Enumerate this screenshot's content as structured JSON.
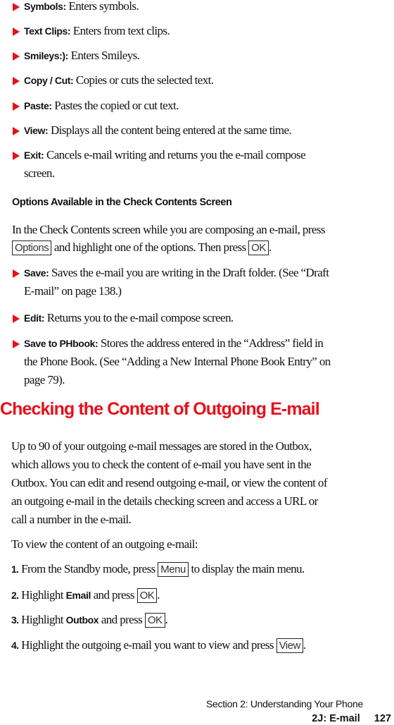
{
  "options_list": [
    {
      "term": "Symbols:",
      "desc": "Enters symbols."
    },
    {
      "term": "Text Clips:",
      "desc": "Enters from text clips."
    },
    {
      "term": "Smileys:):",
      "desc": "Enters Smileys."
    },
    {
      "term": "Copy / Cut:",
      "desc": "Copies or cuts the selected text."
    },
    {
      "term": "Paste:",
      "desc": "Pastes the copied or cut text."
    },
    {
      "term": "View:",
      "desc": "Displays all the content being entered at the same time."
    },
    {
      "term": "Exit:",
      "desc": "Cancels e-mail writing and returns you the e-mail compose",
      "desc2": "screen."
    }
  ],
  "check_contents": {
    "heading": "Options Available in the Check Contents Screen",
    "intro_line1": "In the Check Contents screen while you are composing an e-mail, press",
    "intro_key1": "Options",
    "intro_line2": "and highlight one of the options. Then press",
    "intro_key2": "OK",
    "intro_end": ".",
    "items": [
      {
        "term": "Save:",
        "desc": "Saves the e-mail you are writing in the Draft folder. (See “Draft",
        "desc2": "E-mail” on page 138.)"
      },
      {
        "term": "Edit:",
        "desc": "Returns you to the e-mail compose screen."
      },
      {
        "term": "Save to PHbook:",
        "desc": "Stores the address entered in the “Address” field in",
        "desc2": "the Phone Book. (See “Adding a New Internal Phone Book Entry” on",
        "desc3": "page 79)."
      }
    ]
  },
  "section": {
    "title": "Checking the Content of Outgoing E-mail",
    "paragraph": [
      "Up to 90 of your outgoing e-mail messages are stored in the Outbox,",
      "which allows you to check the content of e-mail you have sent in the",
      "Outbox. You can edit and resend outgoing e-mail, or view the content of",
      "an outgoing e-mail in the details checking screen and access a URL or",
      "call a number in the e-mail."
    ],
    "steps_intro": "To view the content of an outgoing e-mail:",
    "steps": [
      {
        "num": "1.",
        "pre": "From the Standby mode, press",
        "key": "Menu",
        "post": "to display the main menu."
      },
      {
        "num": "2.",
        "pre": "Highlight",
        "bold": "Email",
        "mid": "and press",
        "key": "OK",
        "post": "."
      },
      {
        "num": "3.",
        "pre": "Highlight",
        "bold": "Outbox",
        "mid": "and press",
        "key": "OK",
        "post": "."
      },
      {
        "num": "4.",
        "pre": "Highlight the outgoing e-mail you want to view and press",
        "key": "View",
        "post": "."
      }
    ]
  },
  "footer": {
    "section_label": "Section 2: Understanding Your Phone",
    "chapter_label": "2J: E-mail",
    "page_number": "127"
  },
  "colors": {
    "accent": "#e8101a",
    "text": "#111111"
  }
}
